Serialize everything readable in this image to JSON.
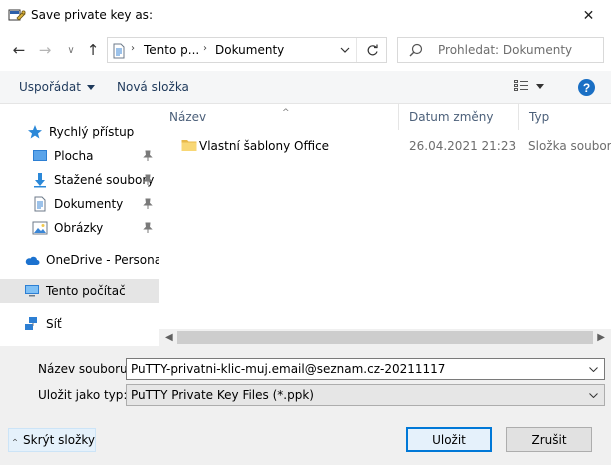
{
  "window": {
    "title": "Save private key as:",
    "close_label": "✕"
  },
  "nav": {
    "back": "←",
    "forward": "→",
    "recent": "∨",
    "up": "↑",
    "address": {
      "segments": [
        "Tento p...",
        "Dokumenty"
      ],
      "separator": "›"
    },
    "search_placeholder": "Prohledat: Dokumenty"
  },
  "commands": {
    "organize": "Uspořádat",
    "new_folder": "Nová složka",
    "help": "?"
  },
  "sidebar": {
    "items": [
      {
        "label": "Rychlý přístup",
        "icon": "star-icon",
        "pinned": false,
        "selected": false
      },
      {
        "label": "Plocha",
        "icon": "desktop-icon",
        "pinned": true,
        "selected": false
      },
      {
        "label": "Stažené soubory",
        "icon": "download-icon",
        "pinned": true,
        "selected": false
      },
      {
        "label": "Dokumenty",
        "icon": "documents-icon",
        "pinned": true,
        "selected": false
      },
      {
        "label": "Obrázky",
        "icon": "pictures-icon",
        "pinned": true,
        "selected": false
      },
      {
        "label": "OneDrive - Personal",
        "icon": "cloud-icon",
        "pinned": false,
        "selected": false
      },
      {
        "label": "Tento počítač",
        "icon": "computer-icon",
        "pinned": false,
        "selected": true
      },
      {
        "label": "Síť",
        "icon": "network-icon",
        "pinned": false,
        "selected": false
      }
    ]
  },
  "files": {
    "columns": [
      "Název",
      "Datum změny",
      "Typ"
    ],
    "rows": [
      {
        "name": "Vlastní šablony Office",
        "date": "26.04.2021 21:23",
        "type": "Složka souborů",
        "icon": "folder-icon"
      }
    ]
  },
  "form": {
    "filename_label": "Název souboru:",
    "filename_value": "PuTTY-privatni-klic-muj.email@seznam.cz-20211117",
    "filetype_label": "Uložit jako typ:",
    "filetype_value": "PuTTY Private Key Files (*.ppk)"
  },
  "footer": {
    "hide_folders": "Skrýt složky",
    "save": "Uložit",
    "cancel": "Zrušit"
  },
  "colors": {
    "accent": "#0078d7",
    "selected_bg": "#e5e5e5",
    "folder": "#f8d775"
  }
}
